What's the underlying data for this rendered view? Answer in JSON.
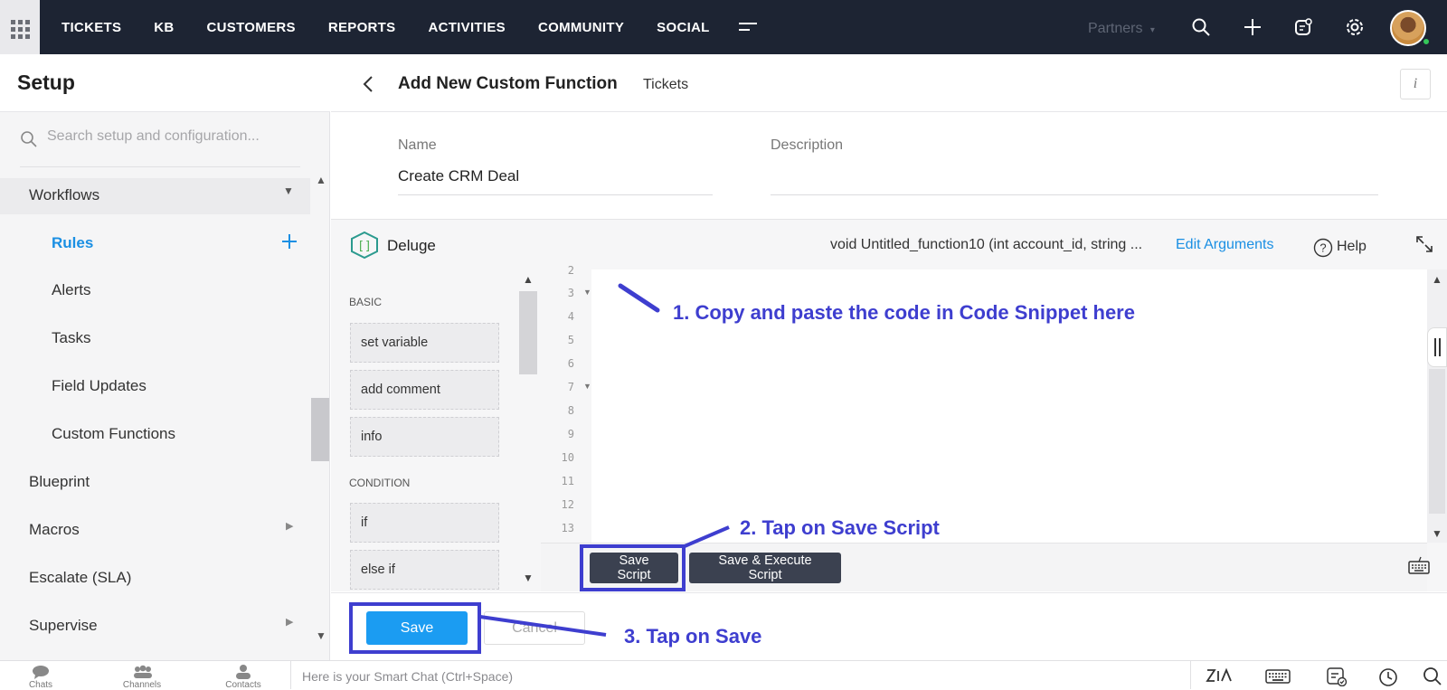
{
  "topbar": {
    "nav": [
      "TICKETS",
      "KB",
      "CUSTOMERS",
      "REPORTS",
      "ACTIVITIES",
      "COMMUNITY",
      "SOCIAL"
    ],
    "partners": "Partners"
  },
  "sidebar": {
    "title": "Setup",
    "search_placeholder": "Search setup and configuration...",
    "workflows": "Workflows",
    "items": [
      "Rules",
      "Alerts",
      "Tasks",
      "Field Updates",
      "Custom Functions"
    ],
    "sections": [
      "Blueprint",
      "Macros",
      "Escalate (SLA)",
      "Supervise"
    ]
  },
  "header": {
    "title": "Add New Custom Function",
    "module": "Tickets",
    "info": "i"
  },
  "form": {
    "name_label": "Name",
    "name_value": "Create CRM Deal",
    "description_label": "Description",
    "description_value": ""
  },
  "editor": {
    "language": "Deluge",
    "signature": "void Untitled_function10 (int account_id, string ...",
    "edit_arguments": "Edit Arguments",
    "help": "Help",
    "categories": {
      "basic": "BASIC",
      "condition": "CONDITION"
    },
    "basic_snippets": [
      "set variable",
      "add comment",
      "info"
    ],
    "condition_snippets": [
      "if",
      "else if"
    ],
    "line_numbers": [
      "2",
      "3",
      "4",
      "5",
      "6",
      "7",
      "8",
      "9",
      "10",
      "11",
      "12",
      "13"
    ],
    "save_script": "Save Script",
    "save_execute": "Save & Execute Script"
  },
  "footer": {
    "save": "Save",
    "cancel": "Cancel"
  },
  "annotations": {
    "step1": "1. Copy and paste the code in Code Snippet here",
    "step2": "2. Tap on Save Script",
    "step3": "3. Tap on Save",
    "color": "#3e3ecf"
  },
  "bottombar": {
    "chats": "Chats",
    "channels": "Channels",
    "contacts": "Contacts",
    "smart_chat": "Here is your Smart Chat (Ctrl+Space)"
  }
}
